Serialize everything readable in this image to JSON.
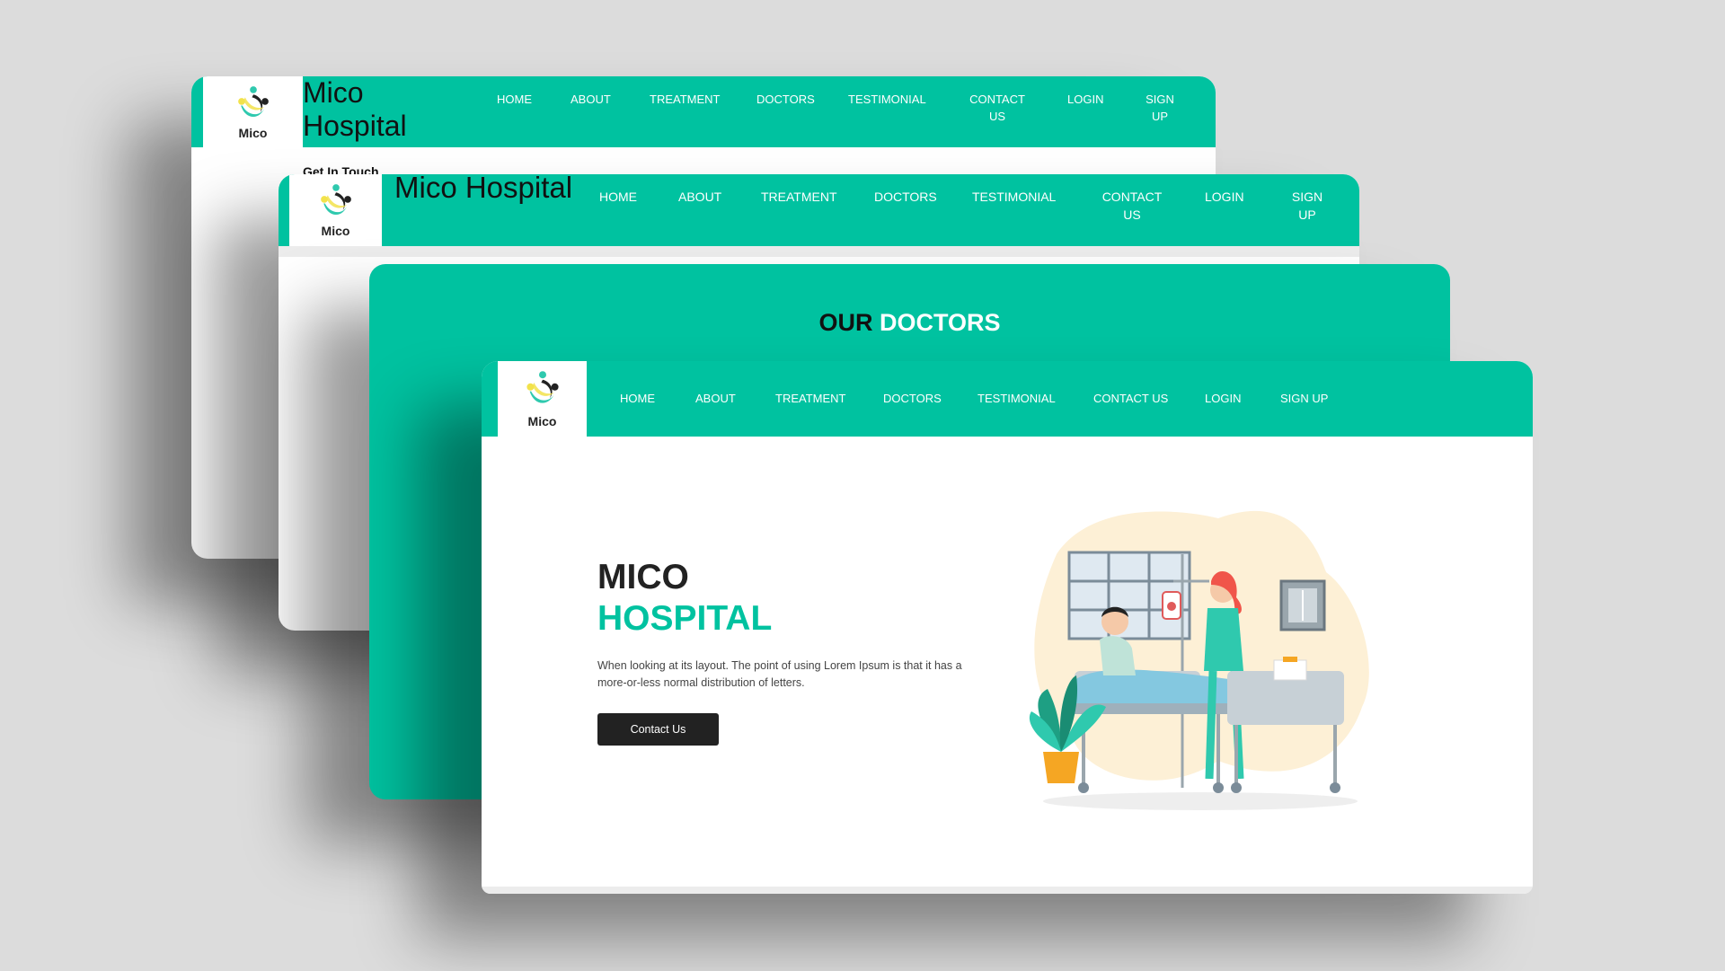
{
  "logo_text": "Mico",
  "brand_name": "Mico Hospital",
  "nav": {
    "home": "HOME",
    "about": "ABOUT",
    "treatment": "TREATMENT",
    "doctors": "DOCTORS",
    "testimonial": "TESTIMONIAL",
    "contact_wrapped": "CONTACT US",
    "contact": "CONTACT US",
    "login": "LOGIN",
    "signup_wrapped": "SIGN UP",
    "signup": "SIGN UP"
  },
  "contact_page": {
    "heading": "Get In Touch"
  },
  "doctors_page": {
    "title_dark": "OUR",
    "title_light": "DOCTORS"
  },
  "hero": {
    "line1": "MICO",
    "line2": "HOSPITAL",
    "description": "When looking at its layout. The point of using Lorem Ipsum is that it has a more-or-less normal distribution of letters.",
    "button_label": "Contact Us"
  },
  "colors": {
    "primary": "#00c2a0",
    "dark": "#222222",
    "background": "#dcdcdc"
  },
  "icons": [
    "mico-logo-icon",
    "hospital-illustration"
  ]
}
